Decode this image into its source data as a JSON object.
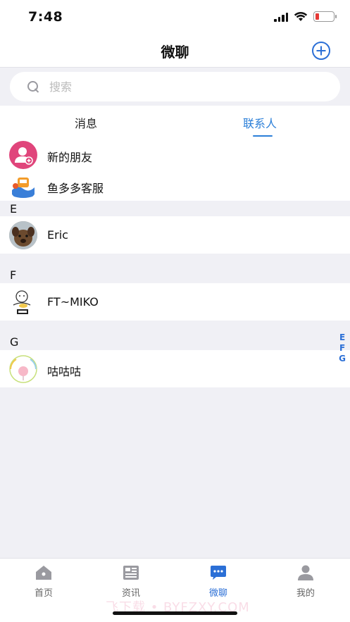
{
  "status_bar": {
    "time": "7:48"
  },
  "header": {
    "title": "微聊"
  },
  "search": {
    "placeholder": "搜索"
  },
  "tabs": [
    {
      "label": "消息",
      "active": false
    },
    {
      "label": "联系人",
      "active": true
    }
  ],
  "top_items": [
    {
      "label": "新的朋友"
    },
    {
      "label": "鱼多多客服"
    }
  ],
  "sections": [
    {
      "letter": "E",
      "contacts": [
        {
          "name": "Eric"
        }
      ]
    },
    {
      "letter": "F",
      "contacts": [
        {
          "name": "FT~MIKO"
        }
      ]
    },
    {
      "letter": "G",
      "contacts": [
        {
          "name": "咕咕咕"
        }
      ]
    }
  ],
  "index_bar": [
    "E",
    "F",
    "G"
  ],
  "bottom_nav": [
    {
      "label": "首页",
      "icon": "home-icon",
      "active": false
    },
    {
      "label": "资讯",
      "icon": "news-icon",
      "active": false
    },
    {
      "label": "微聊",
      "icon": "chat-icon",
      "active": true
    },
    {
      "label": "我的",
      "icon": "profile-icon",
      "active": false
    }
  ],
  "watermark": "飞下载 • BYFZXY.COM",
  "colors": {
    "accent": "#2b6fd6",
    "contacts_tab": "#2b7fd8",
    "new_friend_avatar": "#e0457b",
    "background": "#f0f0f5"
  }
}
